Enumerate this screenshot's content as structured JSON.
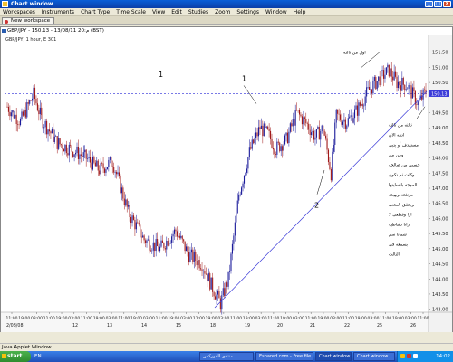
{
  "window": {
    "title": "Chart window",
    "min": "_",
    "max": "□",
    "close": "x"
  },
  "menu": [
    "Workspaces",
    "Instruments",
    "Chart Type",
    "Time Scale",
    "View",
    "Edit",
    "Studies",
    "Zoom",
    "Settings",
    "Window",
    "Help"
  ],
  "workspace": {
    "tab_label": "New workspace"
  },
  "chart": {
    "instrument_header": "GBP/JPY - 150.13 - 13/08/11 20:م (BST)",
    "sub_header": "GBP/JPY, 1 hour, E 301",
    "price_labels": [
      "151.50",
      "151.00",
      "150.50",
      "150.13",
      "149.50",
      "149.00",
      "148.50",
      "148.00",
      "147.50",
      "147.00",
      "146.50",
      "146.00",
      "145.50",
      "145.00",
      "144.50",
      "144.00",
      "143.50",
      "143.00"
    ],
    "current_price": "150.13",
    "start_date": "2/08/08",
    "day_labels": [
      "12",
      "13",
      "14",
      "15",
      "18",
      "19",
      "20",
      "21",
      "22",
      "25",
      "26"
    ],
    "hour_labels": [
      "11:00",
      "19:00",
      "03:00",
      "11:00",
      "19:00",
      "03:00",
      "11:00",
      "19:00",
      "03:00",
      "11:00",
      "19:00",
      "03:00",
      "11:00",
      "19:00",
      "03:00",
      "11:00",
      "19:00",
      "03:00",
      "11:00",
      "19:00",
      "03:00",
      "11:00",
      "19:00",
      "03:00",
      "11:00",
      "19:00",
      "03:00",
      "11:00",
      "19:00",
      "03:00",
      "11:00",
      "19:00",
      "03:00",
      "11:00"
    ],
    "annotations": {
      "label_1_left": "1",
      "label_1_mid": "1",
      "label_2": "2",
      "label_3_top": "اول من ثالثة",
      "arabic_lines": [
        "ثالثه من ثالثة",
        "انتبه الان",
        "مستهدف أو يتبي",
        "ومن من",
        "حسبي من صالحه",
        "وكلت ثم تكون",
        "الموجه بانسايتها",
        "مرتفعه ويهبط",
        "ويحقق المعني",
        "ارا وقطعي لا",
        "ارانا نشاطيه",
        "شمانا سم",
        "بسمعه في",
        "الثالث"
      ]
    },
    "colors": {
      "bull": "#1a1a9a",
      "bear": "#a01818",
      "trend": "#3a3ad8",
      "dashed": "#2a2ad8"
    }
  },
  "status": {
    "java_label": "Java Applet Window"
  },
  "taskbar": {
    "start": "start",
    "lang": "EN",
    "tasks": [
      "منتدى الفوركس",
      "Eshared.com - Free file...",
      "Chart window",
      "Chart window"
    ],
    "clock": "14:02"
  }
}
